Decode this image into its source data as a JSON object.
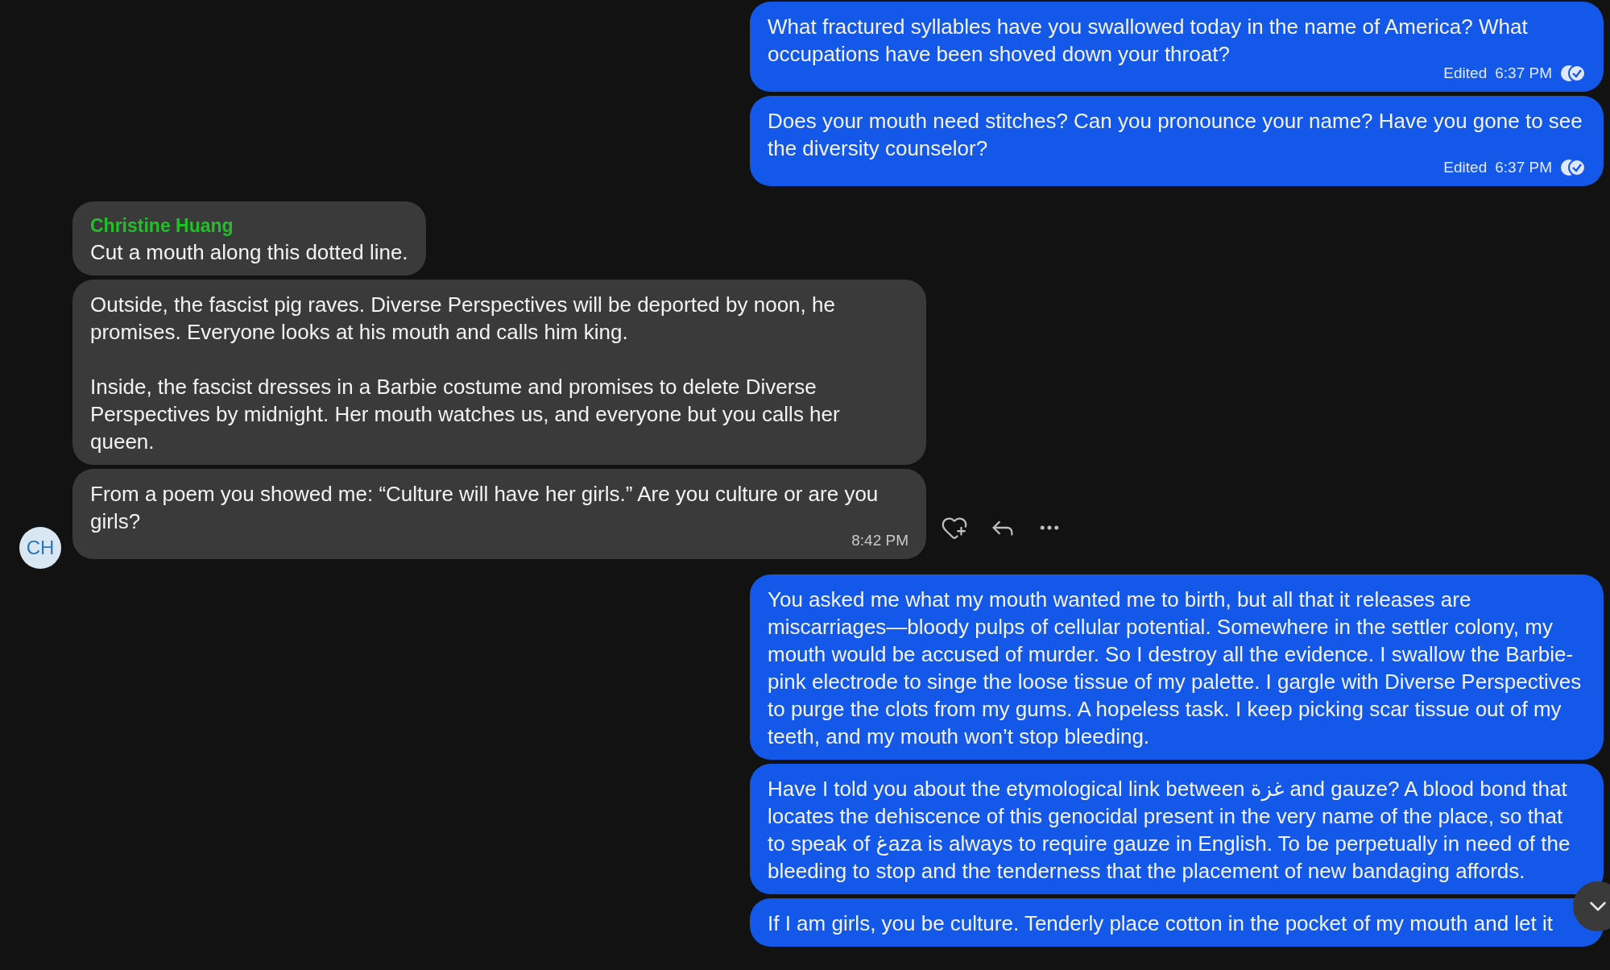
{
  "messages": [
    {
      "kind": "outgoing",
      "paragraphs": [
        "What fractured syllables have you swallowed today in the name of America? What occupations have been shoved down your throat?"
      ],
      "edited": "Edited",
      "time": "6:37 PM",
      "read": true
    },
    {
      "kind": "outgoing",
      "paragraphs": [
        "Does your mouth need stitches? Can you pronounce your name? Have you gone to see the diversity counselor?"
      ],
      "edited": "Edited",
      "time": "6:37 PM",
      "read": true
    },
    {
      "kind": "incoming",
      "sender": "Christine Huang",
      "paragraphs": [
        "Cut a mouth along this dotted line."
      ]
    },
    {
      "kind": "incoming",
      "paragraphs": [
        "Outside, the fascist pig raves. Diverse Perspectives will be deported by noon, he promises. Everyone looks at his mouth and calls him king.",
        "Inside, the fascist dresses in a Barbie costume and promises to delete Diverse Perspectives by midnight. Her mouth watches us, and everyone but you calls her queen."
      ]
    },
    {
      "kind": "incoming",
      "paragraphs": [
        "From a poem you showed me: “Culture will have her girls.” Are you culture or are you girls?"
      ],
      "time": "8:42 PM",
      "avatar": "CH",
      "actions": true
    },
    {
      "kind": "outgoing",
      "paragraphs": [
        "You asked me what my mouth wanted me to birth, but all that it releases are miscarriages—bloody pulps of cellular potential. Somewhere in the settler colony, my mouth would be accused of murder. So I destroy all the evidence. I swallow the Barbie-pink electrode to singe the loose tissue of my palette. I gargle with Diverse Perspectives to purge the clots from my gums. A hopeless task. I keep picking scar tissue out of my teeth, and my mouth won’t stop bleeding."
      ]
    },
    {
      "kind": "outgoing",
      "paragraphs": [
        "Have I told you about the etymological link between غزة and gauze? A blood bond that locates the dehiscence of this genocidal present in the very name of the place, so that to speak of غaza is always to require gauze in English. To be perpetually in need of the bleeding to stop and the tenderness that the placement of new bandaging affords."
      ]
    },
    {
      "kind": "outgoing",
      "paragraphs": [
        "If I am girls, you be culture. Tenderly place cotton in the pocket of my mouth and let it"
      ]
    }
  ]
}
